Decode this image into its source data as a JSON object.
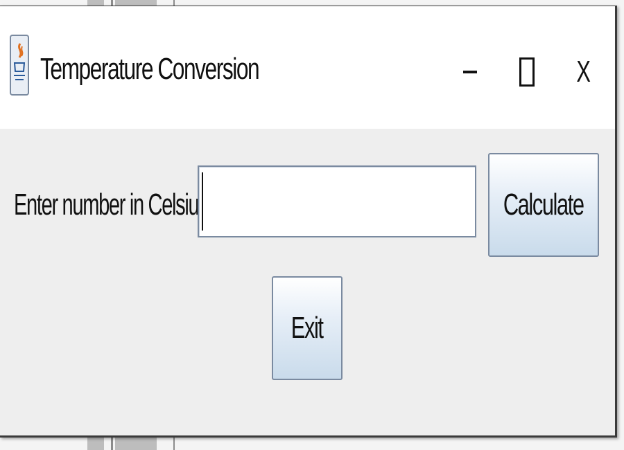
{
  "window": {
    "title": "Temperature Conversion",
    "app_icon": "java-icon",
    "controls": {
      "minimize_icon": "minimize-icon",
      "maximize_icon": "maximize-icon",
      "close_label": "X"
    }
  },
  "form": {
    "celsius_label": "Enter number in Celsius:",
    "celsius_value": "",
    "calculate_label": "Calculate",
    "exit_label": "Exit"
  },
  "colors": {
    "content_bg": "#eeeeee",
    "titlebar_bg": "#ffffff",
    "button_border": "#7a8aa0"
  }
}
